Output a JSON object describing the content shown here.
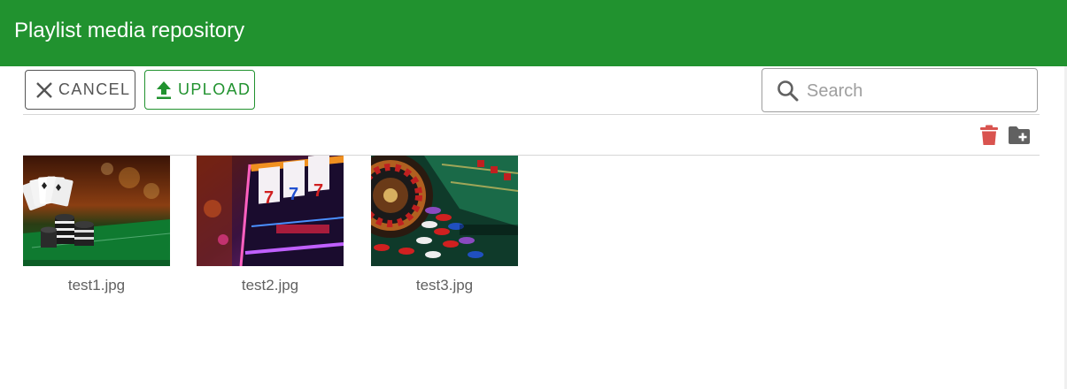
{
  "header": {
    "title": "Playlist media repository",
    "color": "#21922f"
  },
  "toolbar": {
    "cancel_label": "CANCEL",
    "cancel_icon": "close-icon",
    "upload_label": "UPLOAD",
    "upload_icon": "upload-icon"
  },
  "search": {
    "placeholder": "Search",
    "value": "",
    "icon": "search-icon"
  },
  "actions": [
    {
      "name": "delete",
      "icon": "trash-icon",
      "color": "#d9534f"
    },
    {
      "name": "new-folder",
      "icon": "folder-plus-icon",
      "color": "#616161"
    }
  ],
  "media": [
    {
      "filename": "test1.jpg",
      "thumbnail": "playing cards and casino chips on green felt"
    },
    {
      "filename": "test2.jpg",
      "thumbnail": "slot machine reels with purple neon lighting"
    },
    {
      "filename": "test3.jpg",
      "thumbnail": "roulette wheel with stacks of casino chips"
    }
  ]
}
